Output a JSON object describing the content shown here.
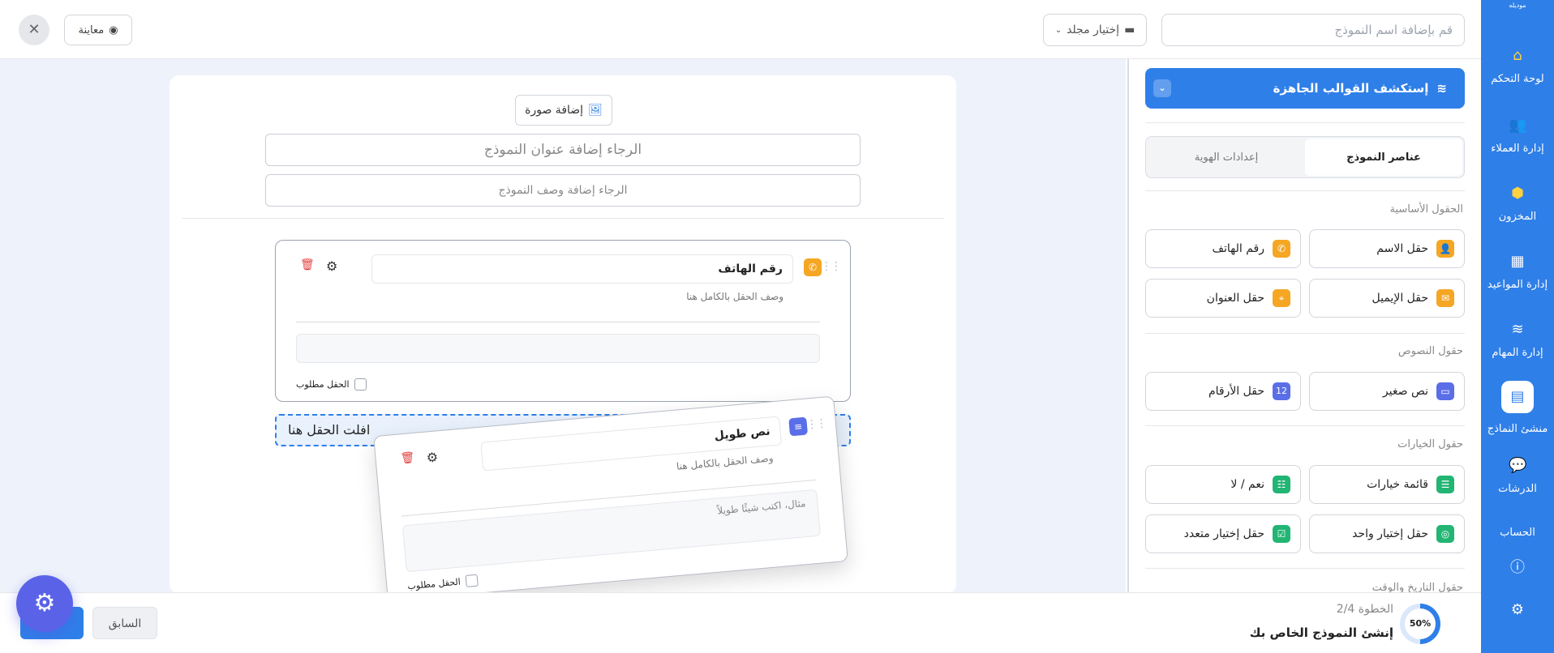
{
  "nav": {
    "logo_text": "موديله",
    "items": [
      {
        "label": "لوحة التحكم",
        "icon": "home-icon"
      },
      {
        "label": "إدارة العملاء",
        "icon": "users-icon"
      },
      {
        "label": "المخزون",
        "icon": "box-icon"
      },
      {
        "label": "إدارة المواعيد",
        "icon": "calendar-icon"
      },
      {
        "label": "إدارة المهام",
        "icon": "layers-icon"
      },
      {
        "label": "منشئ النماذج",
        "icon": "clipboard-icon"
      },
      {
        "label": "الدرشات",
        "icon": "chat-icon"
      },
      {
        "label": "الحساب",
        "icon": "user-icon"
      }
    ],
    "alert_icon": "alert-icon",
    "settings_icon": "gear-icon"
  },
  "topbar": {
    "form_name_placeholder": "قم بإضافة اسم النموذج",
    "folder_label": "إختيار مجلد",
    "preview_label": "معاينة",
    "close_symbol": "✕"
  },
  "canvas": {
    "add_image_label": "إضافة صورة",
    "title_placeholder": "الرجاء إضافة عنوان النموذج",
    "description_placeholder": "الرجاء إضافة وصف النموذج",
    "phone_card": {
      "label": "رقم الهاتف",
      "description": "وصف الحقل بالكامل هنا",
      "required_label": "الحقل مطلوب"
    },
    "drop_zone_label": "افلت الحقل هنا",
    "dragged_card": {
      "label": "نص طويل",
      "description": "وصف الحقل بالكامل هنا",
      "placeholder": "مثال، اكتب شيئًا طويلاً",
      "required_label": "الحقل مطلوب"
    }
  },
  "panel": {
    "explore_label": "إستكشف القوالب الجاهزة",
    "tabs": [
      {
        "label": "عناصر النموذج",
        "active": true
      },
      {
        "label": "إعدادات الهوية",
        "active": false
      }
    ],
    "sections": [
      {
        "title": "الحقول الأساسية"
      },
      {
        "title": "حقول النصوص"
      },
      {
        "title": "حقول الخيارات"
      },
      {
        "title": "حقول التاريخ والوقت"
      }
    ],
    "fields": {
      "name": {
        "label": "حقل الاسم",
        "color": "#f5a623"
      },
      "phone": {
        "label": "رقم الهاتف",
        "color": "#f5a623"
      },
      "email": {
        "label": "حقل الإيميل",
        "color": "#f5a623"
      },
      "address": {
        "label": "حقل العنوان",
        "color": "#f5a623"
      },
      "short_text": {
        "label": "نص صغير",
        "color": "#5a6ee8"
      },
      "numbers": {
        "label": "حقل الأرقام",
        "color": "#5a6ee8",
        "icon_text": "12"
      },
      "choices_list": {
        "label": "قائمة خيارات",
        "color": "#22b573"
      },
      "yes_no": {
        "label": "نعم / لا",
        "color": "#22b573"
      },
      "single_choice": {
        "label": "حقل إختيار واحد",
        "color": "#22b573"
      },
      "multi_choice": {
        "label": "حقل إختيار متعدد",
        "color": "#22b573"
      }
    }
  },
  "footer": {
    "step_text": "الخطوة 2/4",
    "step_title": "إنشئ النموذج الخاص بك",
    "progress_percent": 50,
    "progress_label": "50%",
    "prev_label": "السابق"
  },
  "colors": {
    "primary": "#2f7fe8",
    "fab": "#5a63e8"
  }
}
